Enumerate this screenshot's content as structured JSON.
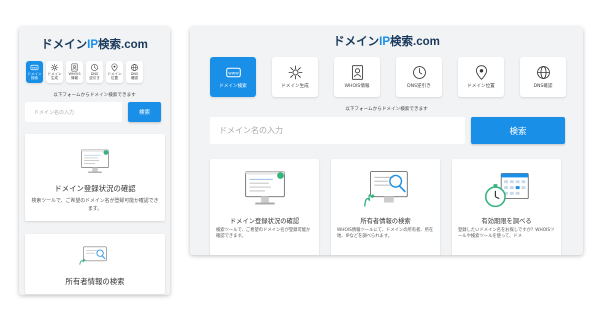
{
  "logo": {
    "left": "ドメイン",
    "ip": "IP",
    "right": "検索.com"
  },
  "nav": [
    {
      "label": "ドメイン検索",
      "mobile_label": [
        "ドメイン",
        "検索"
      ],
      "icon": "www-icon",
      "active": true
    },
    {
      "label": "ドメイン生成",
      "mobile_label": [
        "ドメイン",
        "生成"
      ],
      "icon": "network-icon",
      "active": false
    },
    {
      "label": "WHOIS情報",
      "mobile_label": [
        "WHOIS",
        "情報"
      ],
      "icon": "whois-icon",
      "active": false
    },
    {
      "label": "DNS逆引き",
      "mobile_label": [
        "DNS",
        "逆引き"
      ],
      "icon": "dns-icon",
      "active": false
    },
    {
      "label": "ドメイン位置",
      "mobile_label": [
        "ドメイン",
        "位置"
      ],
      "icon": "location-icon",
      "active": false
    },
    {
      "label": "DNS確認",
      "mobile_label": [
        "DNS",
        "確認"
      ],
      "icon": "globe-icon",
      "active": false
    }
  ],
  "intro": "以下フォームからドメイン検索できます",
  "search": {
    "placeholder": "ドメイン名の入力",
    "button": "検索"
  },
  "mobile_cards": [
    {
      "title": "ドメイン登録状況の確認",
      "desc": "検索ツールで、ご希望のドメイン名が登録可能か確認できます。"
    },
    {
      "title": "所有者情報の検索",
      "desc": ""
    }
  ],
  "cards": [
    {
      "title": "ドメイン登録状況の確認",
      "desc": "検索ツールで、ご希望のドメイン名が登録可能か確認できます。"
    },
    {
      "title": "所有者情報の検索",
      "desc": "WHOIS情報ツールにて、ドメインの所有者、所在地、IPなどを調べられます。"
    },
    {
      "title": "有効期限を調べる",
      "desc": "登録したいドメイン名をお探しですか？WHOISツールや検索ツールを使って、ドメ"
    }
  ],
  "colors": {
    "accent": "#1a8fe8",
    "logo_dark": "#1b3a5c",
    "panel_bg": "#f2f3f5"
  }
}
